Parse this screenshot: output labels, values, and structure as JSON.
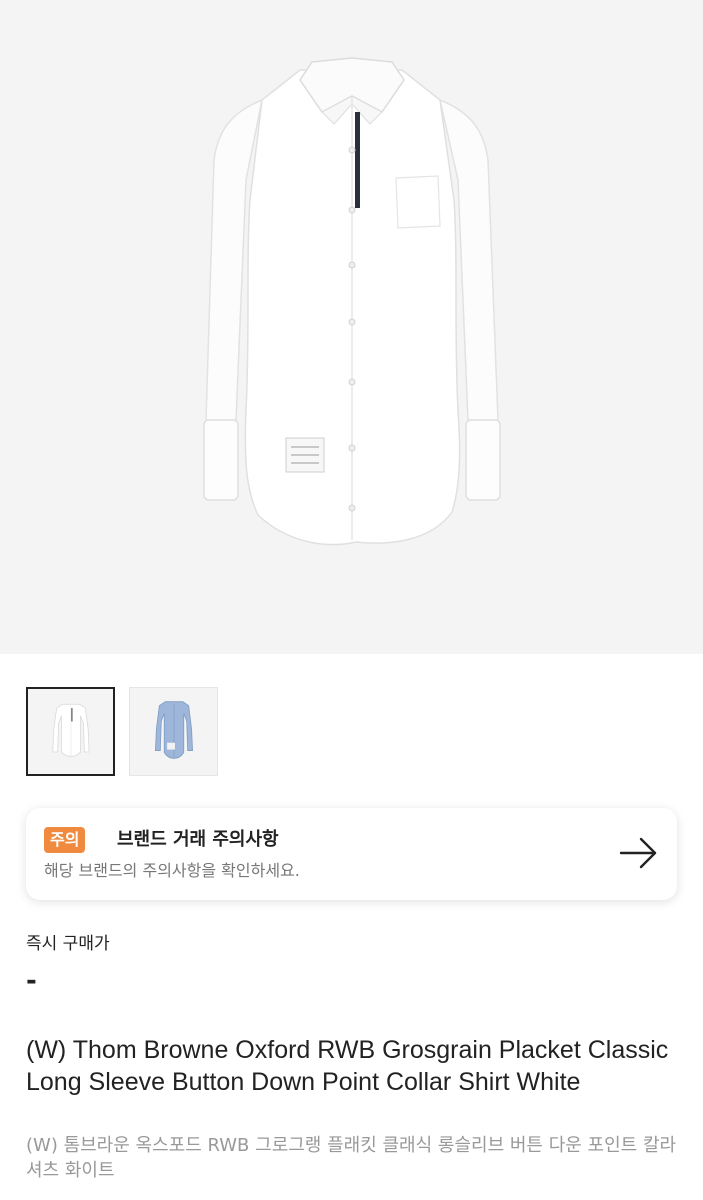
{
  "product": {
    "main_image_icon": "white-shirt-image",
    "thumbnails": [
      {
        "icon": "white-shirt-thumbnail",
        "shirt_color": "#ffffff",
        "selected": true
      },
      {
        "icon": "blue-shirt-thumbnail",
        "shirt_color": "#9db6d9",
        "selected": false
      }
    ],
    "title_en": "(W) Thom Browne Oxford RWB Grosgrain Placket Classic Long Sleeve Button Down Point Collar Shirt White",
    "title_ko": "(W) 톰브라운 옥스포드 RWB 그로그랭 플래킷 클래식 롱슬리브 버튼 다운 포인트 칼라 셔츠 화이트"
  },
  "notice": {
    "badge": "주의",
    "title": "브랜드 거래 주의사항",
    "subtitle": "해당 브랜드의 주의사항을 확인하세요.",
    "arrow_icon": "arrow-right-icon",
    "badge_color": "#f08a3e"
  },
  "price": {
    "label": "즉시 구매가",
    "value": "-"
  }
}
